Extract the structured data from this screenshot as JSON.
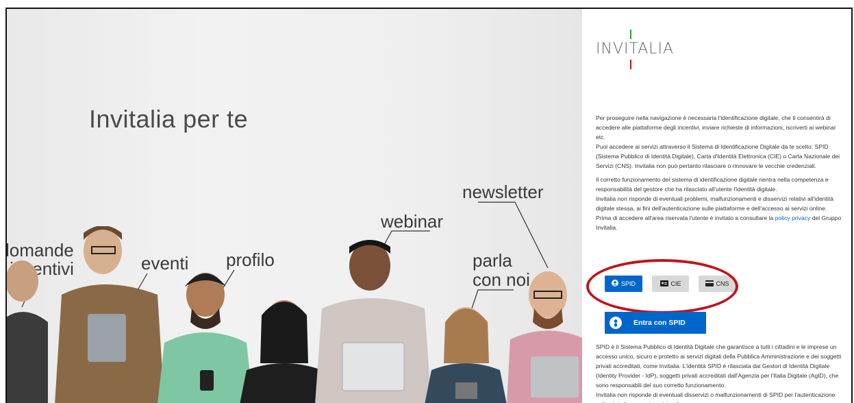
{
  "hero": {
    "title": "Invitalia per te",
    "labels": {
      "domande": "lomande",
      "incentivi": "incentivi",
      "eventi": "eventi",
      "profilo": "profilo",
      "webinar": "webinar",
      "newsletter": "newsletter",
      "parla": "parla",
      "connoi": "con noi"
    }
  },
  "panel": {
    "logo_text": "INVITALIA",
    "colors": {
      "accent": "#0066cc",
      "logo_green": "#2e9e44",
      "logo_red": "#c0141b",
      "ring": "#c0141b"
    },
    "intro": [
      "Per proseguire nella navigazione è necessaria l'identificazione digitale, che ti consentirà di accedere alle piattaforme degli incentivi, inviare richieste di informazioni, iscriverti ai webinar etc.",
      "Puoi accedere ai servizi attraverso il Sistema di Identificazione Digitale da te scelto: SPID (Sistema Pubblico di Identità Digitale), Carta d'Identità Elettronica (CIE) o Carta Nazionale dei Servizi (CNS). Invitalia non può pertanto rilasciare o rinnovare le vecchie credenziali."
    ],
    "liability": [
      "Il corretto funzionamento del sistema di identificazione digitale rientra nella competenza e responsabilità del gestore che ha rilasciato all'utente l'identità digitale.",
      "Invitalia non risponde di eventuali problemi, malfunzionamenti e disservizi relativi all'identità digitale stessa, ai fini dell'autenticazione sulle piattaforme e dell'accesso ai servizi online."
    ],
    "policy_prefix": "Prima di accedere all'area riservata l'utente è invitato a consultare la ",
    "policy_link": "policy privacy",
    "policy_suffix": " del Gruppo Invitalia.",
    "auth_tabs": {
      "spid": "SPID",
      "cie": "CIE",
      "cns": "CNS"
    },
    "enter_spid": "Entra con SPID",
    "spid_info": [
      "SPID è il Sistema Pubblico di Identità Digitale che garantisce a tutti i cittadini e le imprese un accesso unico, sicuro e protetto ai servizi digitali della Pubblica Amministrazione e dei soggetti privati accreditati, come Invitalia. L'identità SPID è rilasciata dai Gestori di Identità Digitale (Identity Provider - IdP), soggetti privati accreditati dall'Agenzia per l'Italia Digitale (AgID), che sono responsabili del suo corretto funzionamento.",
      "Invitalia non risponde di eventuali disservizi o malfunzionamenti di SPID per l'autenticazione sulla piattaforma e ai servizi online."
    ]
  }
}
